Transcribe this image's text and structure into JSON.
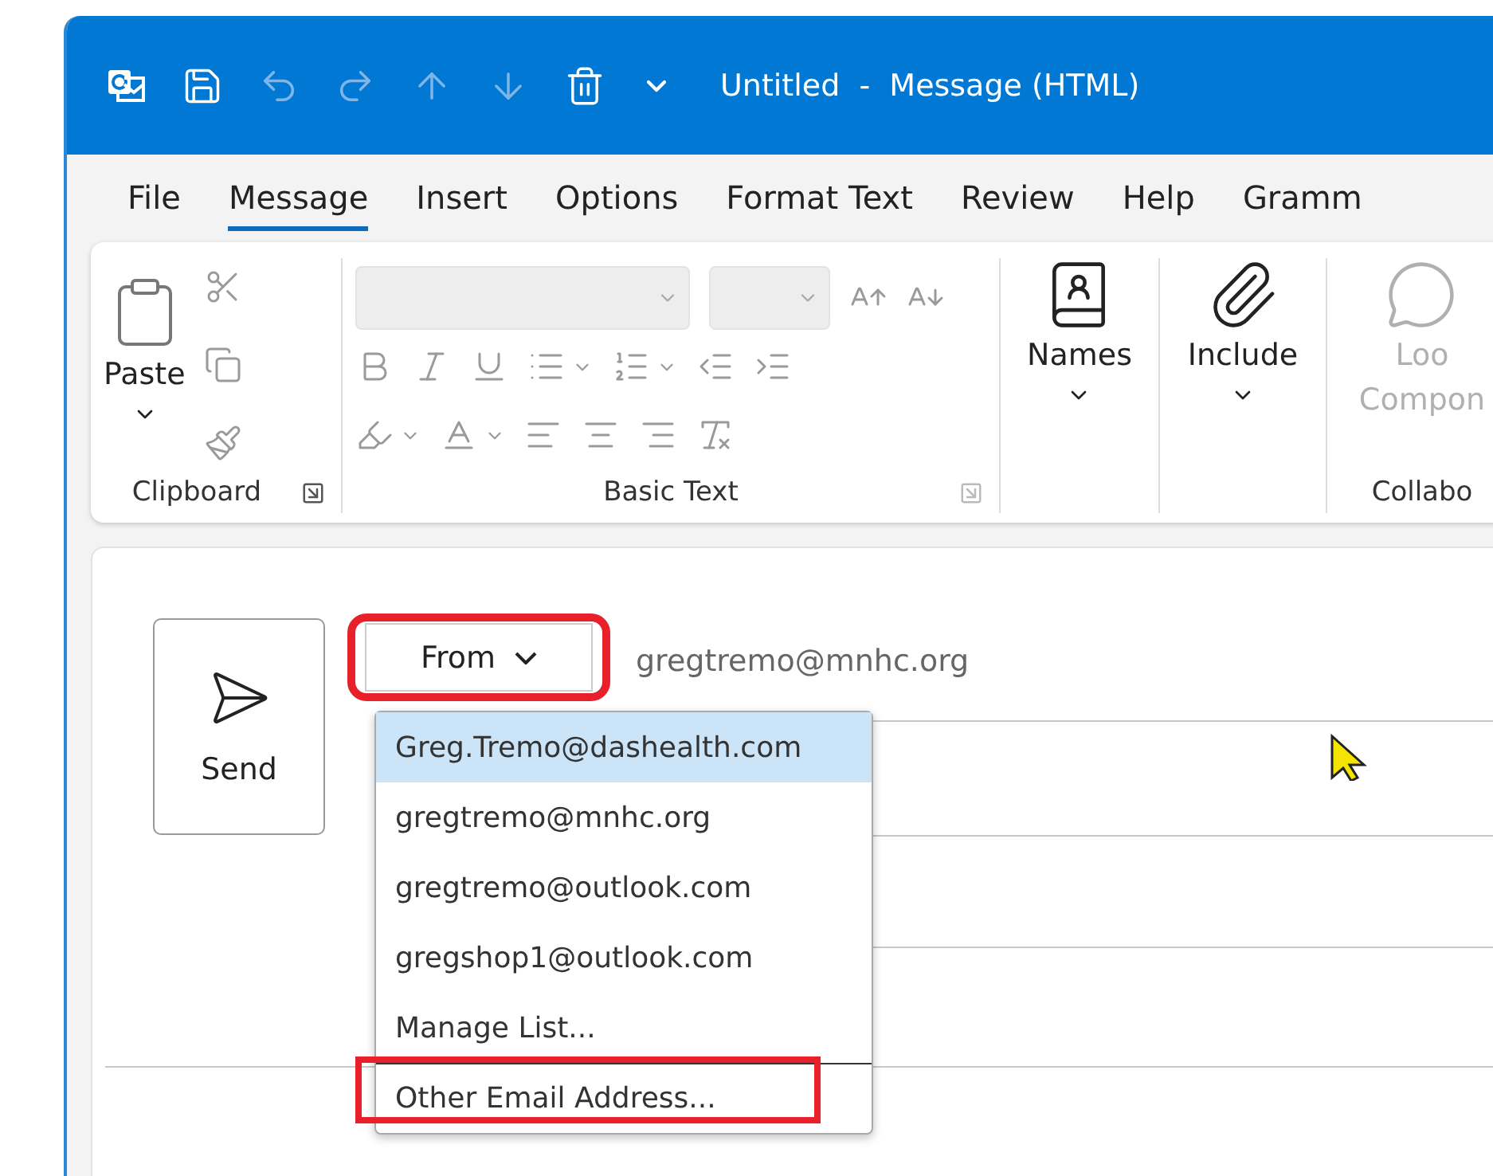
{
  "title_bar": {
    "title": "Untitled  -  Message (HTML)",
    "quick_access": [
      {
        "kind": "app",
        "disabled": false
      },
      {
        "kind": "save",
        "disabled": false
      },
      {
        "kind": "undo",
        "disabled": true
      },
      {
        "kind": "redo",
        "disabled": true
      },
      {
        "kind": "up",
        "disabled": true
      },
      {
        "kind": "down",
        "disabled": true
      },
      {
        "kind": "delete",
        "disabled": false
      },
      {
        "kind": "customize",
        "disabled": false
      }
    ]
  },
  "tabs": [
    {
      "label": "File",
      "selected": false
    },
    {
      "label": "Message",
      "selected": true
    },
    {
      "label": "Insert",
      "selected": false
    },
    {
      "label": "Options",
      "selected": false
    },
    {
      "label": "Format Text",
      "selected": false
    },
    {
      "label": "Review",
      "selected": false
    },
    {
      "label": "Help",
      "selected": false
    },
    {
      "label": "Gramm",
      "selected": false
    }
  ],
  "ribbon": {
    "clipboard": {
      "label": "Clipboard",
      "paste": "Paste",
      "tools": [
        {
          "kind": "cut",
          "disabled": true
        },
        {
          "kind": "copy",
          "disabled": true
        },
        {
          "kind": "format-painter",
          "disabled": true
        }
      ]
    },
    "basic_text": {
      "label": "Basic Text",
      "rows": [
        [
          {
            "kind": "font-name",
            "disabled": true
          },
          {
            "kind": "font-size",
            "disabled": true
          },
          {
            "kind": "grow",
            "disabled": true
          },
          {
            "kind": "shrink",
            "disabled": true
          }
        ],
        [
          {
            "kind": "bold",
            "disabled": true
          },
          {
            "kind": "italic",
            "disabled": true
          },
          {
            "kind": "underline",
            "disabled": true
          },
          {
            "kind": "bullets",
            "disabled": true
          },
          {
            "kind": "numbering",
            "disabled": true
          },
          {
            "kind": "outdent",
            "disabled": true
          },
          {
            "kind": "indent",
            "disabled": true
          }
        ],
        [
          {
            "kind": "highlight",
            "disabled": true
          },
          {
            "kind": "font-color",
            "disabled": true
          },
          {
            "kind": "align-left",
            "disabled": true
          },
          {
            "kind": "align-center",
            "disabled": true
          },
          {
            "kind": "align-right",
            "disabled": true
          },
          {
            "kind": "clear-format",
            "disabled": true
          }
        ]
      ]
    },
    "big_buttons": [
      {
        "kind": "names",
        "lines": [
          "Names"
        ],
        "disabled": false
      },
      {
        "kind": "include",
        "lines": [
          "Include"
        ],
        "disabled": false
      },
      {
        "kind": "loop",
        "lines": [
          "Loo",
          "Compon"
        ],
        "disabled": true,
        "group": "Collabo"
      }
    ]
  },
  "compose": {
    "send": "Send",
    "from_button": {
      "label": "From",
      "annotated": true
    },
    "from_value": "gregtremo@mnhc.org",
    "from_menu": [
      {
        "label": "Greg.Tremo@dashealth.com",
        "selected": true,
        "annotated": false,
        "separator_before": false
      },
      {
        "label": "gregtremo@mnhc.org",
        "selected": false,
        "annotated": false,
        "separator_before": false
      },
      {
        "label": "gregtremo@outlook.com",
        "selected": false,
        "annotated": false,
        "separator_before": false
      },
      {
        "label": "gregshop1@outlook.com",
        "selected": false,
        "annotated": false,
        "separator_before": false
      },
      {
        "label": "Manage List...",
        "selected": false,
        "annotated": false,
        "separator_before": false
      },
      {
        "label": "Other Email Address...",
        "selected": false,
        "annotated": true,
        "separator_before": true
      }
    ]
  }
}
